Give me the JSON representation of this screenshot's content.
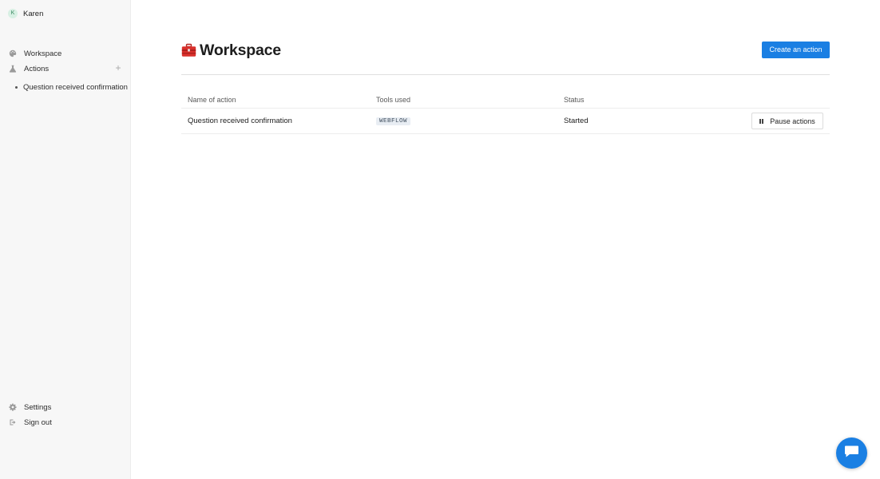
{
  "sidebar": {
    "user": {
      "initial": "K",
      "name": "Karen"
    },
    "nav": {
      "workspace": {
        "label": "Workspace",
        "icon": "palette-icon"
      },
      "actions": {
        "label": "Actions",
        "icon": "flask-icon",
        "add_icon": "plus-icon"
      },
      "actions_items": [
        {
          "label": "Question received confirmation"
        }
      ]
    },
    "footer": {
      "settings": {
        "label": "Settings",
        "icon": "gear-icon"
      },
      "signout": {
        "label": "Sign out",
        "icon": "sign-out-icon"
      }
    }
  },
  "main": {
    "title": "Workspace",
    "title_icon": "toolbox-icon",
    "create_button_label": "Create an action",
    "table": {
      "columns": [
        "Name of action",
        "Tools used",
        "Status"
      ],
      "rows": [
        {
          "name": "Question received confirmation",
          "tool": "WEBFLOW",
          "status": "Started",
          "action_label": "Pause actions",
          "action_icon": "pause-icon"
        }
      ]
    }
  },
  "chat": {
    "icon": "chat-bubble-icon"
  },
  "colors": {
    "accent": "#1a7fe3",
    "sidebar_bg": "#f7f7f7",
    "tag_bg": "#e8edf3",
    "toolbox_red": "#d9302c"
  }
}
